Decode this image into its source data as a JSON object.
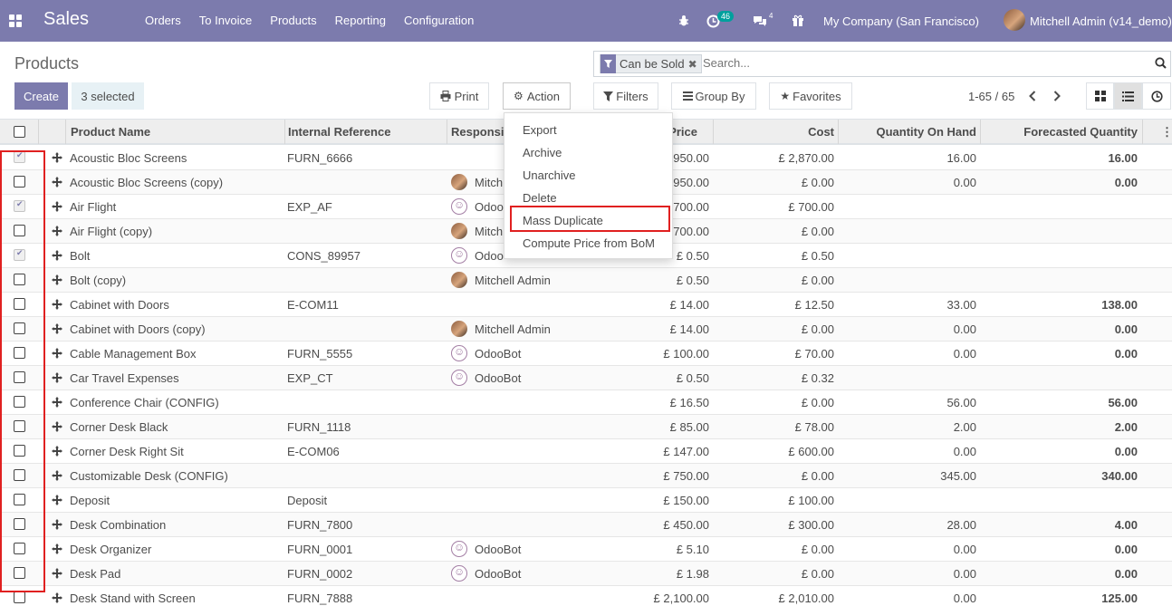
{
  "navbar": {
    "app_name": "Sales",
    "menu": [
      "Orders",
      "To Invoice",
      "Products",
      "Reporting",
      "Configuration"
    ],
    "activity_badge": "46",
    "message_badge": "4",
    "company": "My Company (San Francisco)",
    "user": "Mitchell Admin (v14_demo)"
  },
  "control": {
    "title": "Products",
    "create_label": "Create",
    "selected_label": "3 selected",
    "print_label": "Print",
    "action_label": "Action",
    "filters_label": "Filters",
    "groupby_label": "Group By",
    "favorites_label": "Favorites",
    "facet_label": "Can be Sold",
    "search_placeholder": "Search...",
    "pager": "1-65 / 65"
  },
  "action_menu": [
    "Export",
    "Archive",
    "Unarchive",
    "Delete",
    "Mass Duplicate",
    "Compute Price from BoM"
  ],
  "columns": {
    "name": "Product Name",
    "ref": "Internal Reference",
    "resp": "Responsi",
    "price": "Price",
    "cost": "Cost",
    "qoh": "Quantity On Hand",
    "forecast": "Forecasted Quantity"
  },
  "rows": [
    {
      "checked": true,
      "name": "Acoustic Bloc Screens",
      "ref": "FURN_6666",
      "resp": "",
      "avatar": "",
      "price": "950.00",
      "cost": "£ 2,870.00",
      "qoh": "16.00",
      "forecast": "16.00"
    },
    {
      "checked": false,
      "name": "Acoustic Bloc Screens (copy)",
      "ref": "",
      "resp": "Mitch",
      "avatar": "mitchell",
      "price": "950.00",
      "cost": "£ 0.00",
      "qoh": "0.00",
      "forecast": "0.00"
    },
    {
      "checked": true,
      "name": "Air Flight",
      "ref": "EXP_AF",
      "resp": "Odoo",
      "avatar": "bot",
      "price": "700.00",
      "cost": "£ 700.00",
      "qoh": "",
      "forecast": ""
    },
    {
      "checked": false,
      "name": "Air Flight (copy)",
      "ref": "",
      "resp": "Mitch",
      "avatar": "mitchell",
      "price": "700.00",
      "cost": "£ 0.00",
      "qoh": "",
      "forecast": ""
    },
    {
      "checked": true,
      "name": "Bolt",
      "ref": "CONS_89957",
      "resp": "Odoo",
      "avatar": "bot",
      "price": "£ 0.50",
      "cost": "£ 0.50",
      "qoh": "",
      "forecast": ""
    },
    {
      "checked": false,
      "name": "Bolt (copy)",
      "ref": "",
      "resp": "Mitchell Admin",
      "avatar": "mitchell",
      "price": "£ 0.50",
      "cost": "£ 0.00",
      "qoh": "",
      "forecast": ""
    },
    {
      "checked": false,
      "name": "Cabinet with Doors",
      "ref": "E-COM11",
      "resp": "",
      "avatar": "",
      "price": "£ 14.00",
      "cost": "£ 12.50",
      "qoh": "33.00",
      "forecast": "138.00"
    },
    {
      "checked": false,
      "name": "Cabinet with Doors (copy)",
      "ref": "",
      "resp": "Mitchell Admin",
      "avatar": "mitchell",
      "price": "£ 14.00",
      "cost": "£ 0.00",
      "qoh": "0.00",
      "forecast": "0.00"
    },
    {
      "checked": false,
      "name": "Cable Management Box",
      "ref": "FURN_5555",
      "resp": "OdooBot",
      "avatar": "bot",
      "price": "£ 100.00",
      "cost": "£ 70.00",
      "qoh": "0.00",
      "forecast": "0.00"
    },
    {
      "checked": false,
      "name": "Car Travel Expenses",
      "ref": "EXP_CT",
      "resp": "OdooBot",
      "avatar": "bot",
      "price": "£ 0.50",
      "cost": "£ 0.32",
      "qoh": "",
      "forecast": ""
    },
    {
      "checked": false,
      "name": "Conference Chair (CONFIG)",
      "ref": "",
      "resp": "",
      "avatar": "",
      "price": "£ 16.50",
      "cost": "£ 0.00",
      "qoh": "56.00",
      "forecast": "56.00"
    },
    {
      "checked": false,
      "name": "Corner Desk Black",
      "ref": "FURN_1118",
      "resp": "",
      "avatar": "",
      "price": "£ 85.00",
      "cost": "£ 78.00",
      "qoh": "2.00",
      "forecast": "2.00"
    },
    {
      "checked": false,
      "name": "Corner Desk Right Sit",
      "ref": "E-COM06",
      "resp": "",
      "avatar": "",
      "price": "£ 147.00",
      "cost": "£ 600.00",
      "qoh": "0.00",
      "forecast": "0.00"
    },
    {
      "checked": false,
      "name": "Customizable Desk (CONFIG)",
      "ref": "",
      "resp": "",
      "avatar": "",
      "price": "£ 750.00",
      "cost": "£ 0.00",
      "qoh": "345.00",
      "forecast": "340.00"
    },
    {
      "checked": false,
      "name": "Deposit",
      "ref": "Deposit",
      "resp": "",
      "avatar": "",
      "price": "£ 150.00",
      "cost": "£ 100.00",
      "qoh": "",
      "forecast": ""
    },
    {
      "checked": false,
      "name": "Desk Combination",
      "ref": "FURN_7800",
      "resp": "",
      "avatar": "",
      "price": "£ 450.00",
      "cost": "£ 300.00",
      "qoh": "28.00",
      "forecast": "4.00"
    },
    {
      "checked": false,
      "name": "Desk Organizer",
      "ref": "FURN_0001",
      "resp": "OdooBot",
      "avatar": "bot",
      "price": "£ 5.10",
      "cost": "£ 0.00",
      "qoh": "0.00",
      "forecast": "0.00"
    },
    {
      "checked": false,
      "name": "Desk Pad",
      "ref": "FURN_0002",
      "resp": "OdooBot",
      "avatar": "bot",
      "price": "£ 1.98",
      "cost": "£ 0.00",
      "qoh": "0.00",
      "forecast": "0.00"
    },
    {
      "checked": false,
      "name": "Desk Stand with Screen",
      "ref": "FURN_7888",
      "resp": "",
      "avatar": "",
      "price": "£ 2,100.00",
      "cost": "£ 2,010.00",
      "qoh": "0.00",
      "forecast": "125.00"
    }
  ]
}
